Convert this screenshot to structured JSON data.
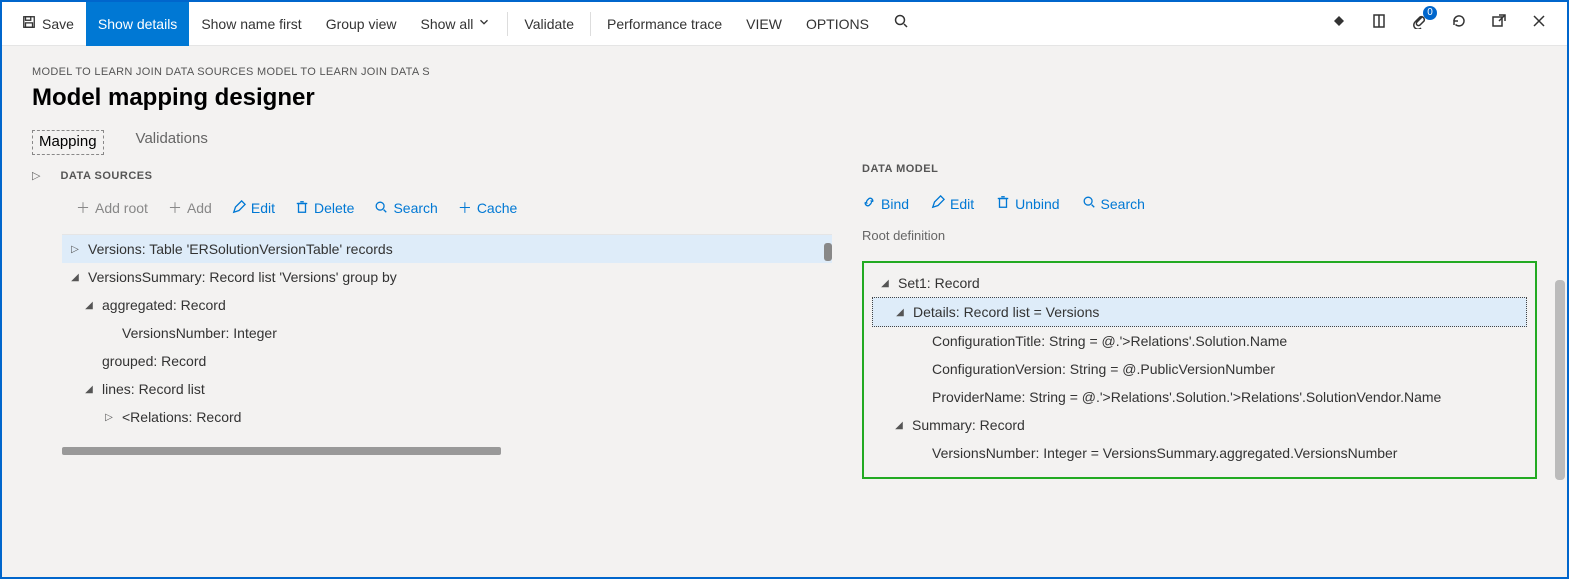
{
  "ribbon": {
    "save": "Save",
    "show_details": "Show details",
    "show_name_first": "Show name first",
    "group_view": "Group view",
    "show_all": "Show all",
    "validate": "Validate",
    "perf_trace": "Performance trace",
    "view": "VIEW",
    "options": "OPTIONS",
    "attachment_count": "0"
  },
  "breadcrumb": "MODEL TO LEARN JOIN DATA SOURCES MODEL TO LEARN JOIN DATA S",
  "page_title": "Model mapping designer",
  "tabs": {
    "mapping": "Mapping",
    "validations": "Validations"
  },
  "left": {
    "heading": "DATA SOURCES",
    "toolbar": {
      "add_root": "Add root",
      "add": "Add",
      "edit": "Edit",
      "delete": "Delete",
      "search": "Search",
      "cache": "Cache"
    },
    "tree": {
      "versions": "Versions: Table 'ERSolutionVersionTable' records",
      "versions_summary": "VersionsSummary: Record list 'Versions' group by",
      "aggregated": "aggregated: Record",
      "versions_number": "VersionsNumber: Integer",
      "grouped": "grouped: Record",
      "lines": "lines: Record list",
      "relations": "<Relations: Record"
    }
  },
  "right": {
    "heading": "DATA MODEL",
    "toolbar": {
      "bind": "Bind",
      "edit": "Edit",
      "unbind": "Unbind",
      "search": "Search"
    },
    "root_def": "Root definition",
    "tree": {
      "set1": "Set1: Record",
      "details": "Details: Record list = Versions",
      "conf_title": "ConfigurationTitle: String = @.'>Relations'.Solution.Name",
      "conf_version": "ConfigurationVersion: String = @.PublicVersionNumber",
      "provider": "ProviderName: String = @.'>Relations'.Solution.'>Relations'.SolutionVendor.Name",
      "summary": "Summary: Record",
      "versions_number": "VersionsNumber: Integer = VersionsSummary.aggregated.VersionsNumber"
    }
  }
}
